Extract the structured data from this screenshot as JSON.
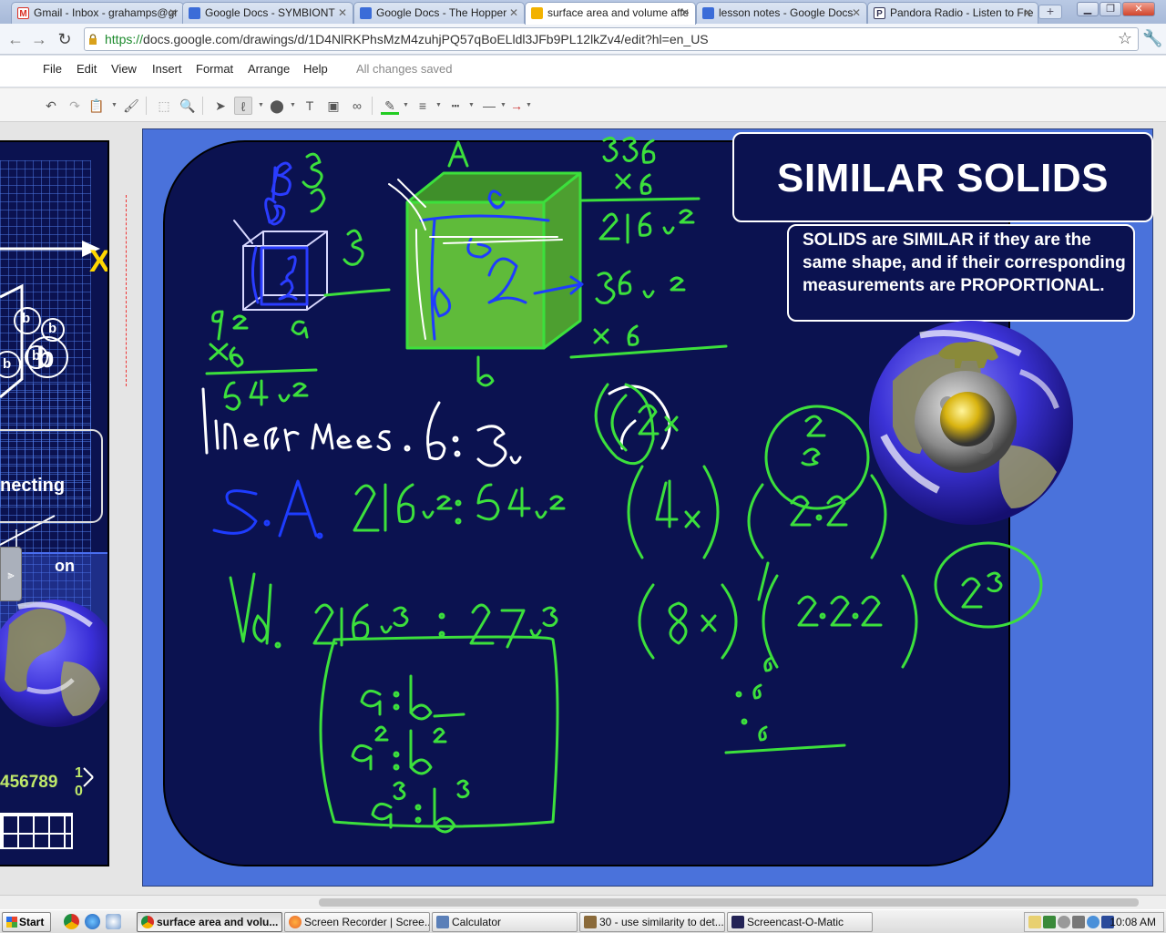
{
  "tabs": [
    {
      "label": "Gmail - Inbox - grahamps@gr",
      "icon": "gmail-icon",
      "color": "#d93025"
    },
    {
      "label": "Google Docs - SYMBIONT",
      "icon": "docs-icon",
      "color": "#3b6cd8"
    },
    {
      "label": "Google Docs - The Hopper",
      "icon": "docs-icon",
      "color": "#3b6cd8"
    },
    {
      "label": "surface area and volume affe",
      "icon": "drawings-icon",
      "color": "#f2b200"
    },
    {
      "label": "lesson notes - Google Docs",
      "icon": "docs-icon",
      "color": "#3b6cd8"
    },
    {
      "label": "Pandora Radio - Listen to Fre",
      "icon": "pandora-icon",
      "color": "#335"
    }
  ],
  "address": {
    "proto": "https://",
    "rest": "docs.google.com/drawings/d/1D4NlRKPhsMzM4zuhjPQ57qBoELldl3JFb9PL12lkZv4/edit?hl=en_US"
  },
  "menu": {
    "items": [
      "File",
      "Edit",
      "View",
      "Insert",
      "Format",
      "Arrange",
      "Help"
    ],
    "status": "All changes saved"
  },
  "left_slide": {
    "axis_letter": "X",
    "word1": "necting",
    "word2": "on",
    "digits": "456789",
    "digit_tail_top": "1",
    "digit_tail_bottom": "0",
    "badge_small": "b",
    "badge_large": "b"
  },
  "slide": {
    "title": "SIMILAR SOLIDS",
    "definition": "SOLIDS are SIMILAR if they are the same shape, and if their corresponding measurements are PROPORTIONAL.",
    "accent_green": "#3ce03c",
    "accent_blue": "#1e3cff",
    "board_color": "#0b1250"
  },
  "taskbar": {
    "start": "Start",
    "tasks": [
      {
        "label": "surface area and volu...",
        "color": "#f2b200"
      },
      {
        "label": "Screen Recorder | Scree...",
        "color": "#e8652b"
      },
      {
        "label": "Calculator",
        "color": "#5a7fb8"
      },
      {
        "label": "30 - use similarity to det...",
        "color": "#8a6a3a"
      },
      {
        "label": "Screencast-O-Matic",
        "color": "#225"
      }
    ],
    "clock": "10:08 AM"
  }
}
